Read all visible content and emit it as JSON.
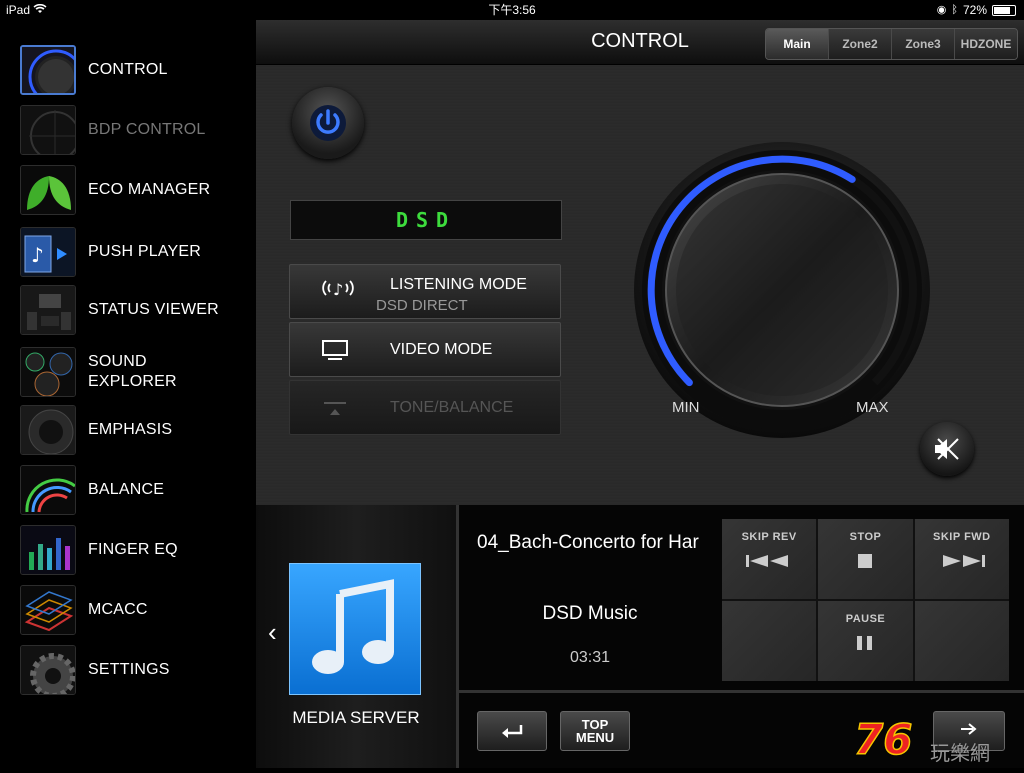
{
  "status_bar": {
    "device": "iPad",
    "time": "下午3:56",
    "battery": "72%"
  },
  "sidebar": {
    "items": [
      {
        "label": "CONTROL",
        "icon": "control-knob-icon"
      },
      {
        "label": "BDP CONTROL",
        "icon": "bdp-control-icon"
      },
      {
        "label": "ECO MANAGER",
        "icon": "leaf-icon"
      },
      {
        "label": "PUSH PLAYER",
        "icon": "push-player-icon"
      },
      {
        "label": "STATUS VIEWER",
        "icon": "status-viewer-icon"
      },
      {
        "label": "SOUND EXPLORER",
        "icon": "sound-explorer-icon"
      },
      {
        "label": "EMPHASIS",
        "icon": "speaker-icon"
      },
      {
        "label": "BALANCE",
        "icon": "balance-icon"
      },
      {
        "label": "FINGER EQ",
        "icon": "equalizer-icon"
      },
      {
        "label": "MCACC",
        "icon": "mcacc-icon"
      },
      {
        "label": "SETTINGS",
        "icon": "gear-icon"
      }
    ]
  },
  "header": {
    "title": "CONTROL",
    "zones": [
      "Main",
      "Zone2",
      "Zone3",
      "HDZONE"
    ],
    "active_zone": "Main"
  },
  "control": {
    "display_text": "DSD",
    "modes": [
      {
        "label": "LISTENING MODE",
        "sub": "DSD DIRECT",
        "icon": "music-note-waves-icon"
      },
      {
        "label": "VIDEO MODE",
        "icon": "monitor-icon"
      },
      {
        "label": "TONE/BALANCE",
        "icon": "tone-balance-icon",
        "disabled": true
      }
    ],
    "volume": {
      "min_label": "MIN",
      "max_label": "MAX",
      "level": 0.62
    }
  },
  "media": {
    "source_label": "MEDIA SERVER",
    "track_title": "04_Bach-Concerto for Har",
    "album": "DSD Music",
    "time": "03:31",
    "transport": {
      "skip_rev": "SKIP REV",
      "stop": "STOP",
      "skip_fwd": "SKIP FWD",
      "pause": "PAUSE"
    },
    "top_menu": "TOP\nMENU"
  },
  "watermark": {
    "text": "76",
    "sub": "玩樂網"
  },
  "colors": {
    "accent_blue": "#2f5cff",
    "display_green": "#3ddc3d",
    "tile_blue": "#1a8cf0"
  }
}
